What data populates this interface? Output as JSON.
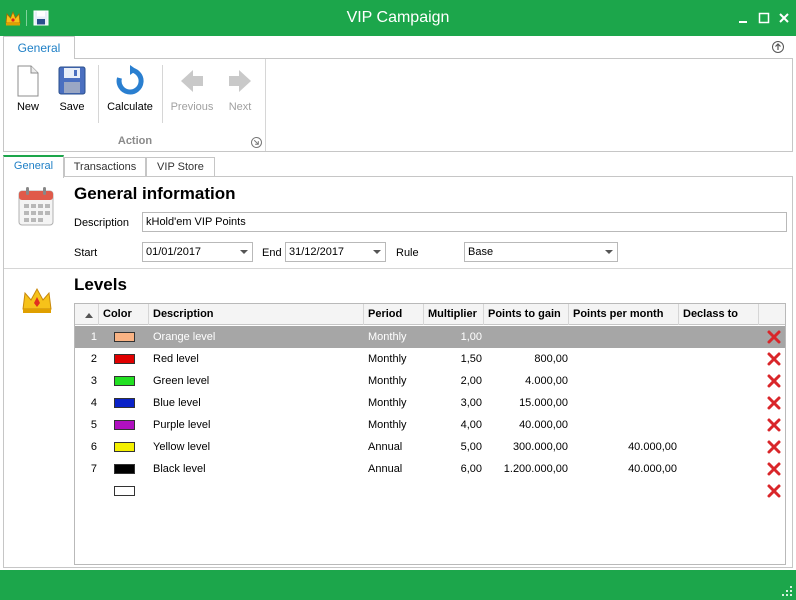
{
  "window": {
    "title": "VIP Campaign"
  },
  "ribbon": {
    "tab_label": "General",
    "group_label": "Action",
    "buttons": {
      "new": "New",
      "save": "Save",
      "calculate": "Calculate",
      "previous": "Previous",
      "next": "Next"
    }
  },
  "tabs": [
    {
      "label": "General"
    },
    {
      "label": "Transactions"
    },
    {
      "label": "VIP Store"
    }
  ],
  "general": {
    "title": "General information",
    "description_label": "Description",
    "description_value": "kHold'em VIP Points",
    "start_label": "Start",
    "start_value": "01/01/2017",
    "end_label": "End",
    "end_value": "31/12/2017",
    "rule_label": "Rule",
    "rule_value": "Base"
  },
  "levels": {
    "title": "Levels",
    "columns": {
      "color": "Color",
      "description": "Description",
      "period": "Period",
      "multiplier": "Multiplier",
      "points_to_gain": "Points to gain",
      "points_per_month": "Points per month",
      "declass_to": "Declass to"
    },
    "rows": [
      {
        "index": "1",
        "color": "#f9b384",
        "description": "Orange level",
        "period": "Monthly",
        "multiplier": "1,00",
        "points_to_gain": "",
        "points_per_month": "",
        "declass_to": ""
      },
      {
        "index": "2",
        "color": "#e00000",
        "description": "Red level",
        "period": "Monthly",
        "multiplier": "1,50",
        "points_to_gain": "800,00",
        "points_per_month": "",
        "declass_to": ""
      },
      {
        "index": "3",
        "color": "#22e022",
        "description": "Green level",
        "period": "Monthly",
        "multiplier": "2,00",
        "points_to_gain": "4.000,00",
        "points_per_month": "",
        "declass_to": ""
      },
      {
        "index": "4",
        "color": "#0a22c8",
        "description": "Blue level",
        "period": "Monthly",
        "multiplier": "3,00",
        "points_to_gain": "15.000,00",
        "points_per_month": "",
        "declass_to": ""
      },
      {
        "index": "5",
        "color": "#b010c0",
        "description": "Purple level",
        "period": "Monthly",
        "multiplier": "4,00",
        "points_to_gain": "40.000,00",
        "points_per_month": "",
        "declass_to": ""
      },
      {
        "index": "6",
        "color": "#f4f000",
        "description": "Yellow level",
        "period": "Annual",
        "multiplier": "5,00",
        "points_to_gain": "300.000,00",
        "points_per_month": "40.000,00",
        "declass_to": ""
      },
      {
        "index": "7",
        "color": "#000000",
        "description": "Black level",
        "period": "Annual",
        "multiplier": "6,00",
        "points_to_gain": "1.200.000,00",
        "points_per_month": "40.000,00",
        "declass_to": ""
      },
      {
        "index": "",
        "color": "#ffffff",
        "description": "",
        "period": "",
        "multiplier": "",
        "points_to_gain": "",
        "points_per_month": "",
        "declass_to": ""
      }
    ]
  },
  "colors": {
    "accent": "#1ca64b",
    "link": "#1e7fc6",
    "selected_row": "#a6a6a6",
    "delete": "#d9262a"
  },
  "icons": {
    "app": "crown-icon",
    "quick_save": "save-icon",
    "calendar": "calendar-icon",
    "levels": "crown-icon",
    "delete": "delete-icon"
  }
}
